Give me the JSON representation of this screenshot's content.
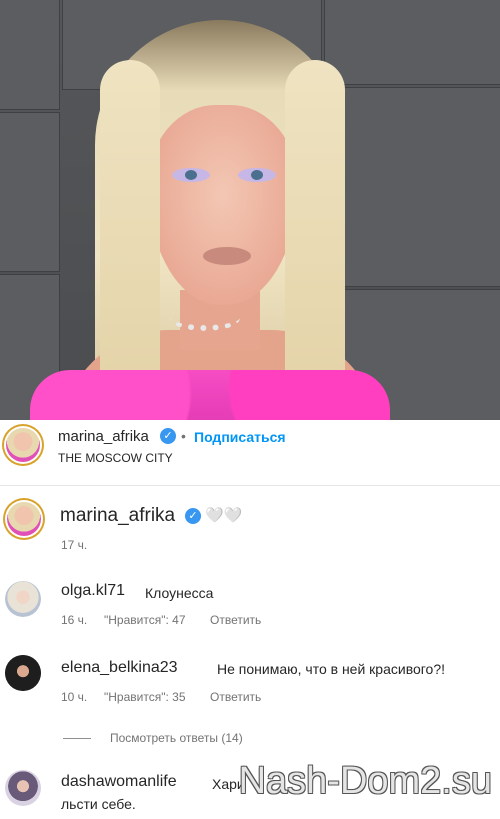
{
  "post_header": {
    "username": "marina_afrika",
    "separator": "•",
    "follow_label": "Подписаться",
    "location": "THE MOSCOW CITY"
  },
  "caption": {
    "username": "marina_afrika",
    "emoji": "🤍🤍",
    "time": "17 ч."
  },
  "comments": [
    {
      "username": "olga.kl71",
      "text": "Клоунесса",
      "time": "16 ч.",
      "likes": "\"Нравится\": 47",
      "reply_label": "Ответить"
    },
    {
      "username": "elena_belkina23",
      "text": "Не понимаю, что в ней красивого?!",
      "time": "10 ч.",
      "likes": "\"Нравится\": 35",
      "reply_label": "Ответить"
    }
  ],
  "view_replies": "Посмотреть ответы (14)",
  "last_comment": {
    "username": "dashawomanlife",
    "text_line1": "Хари",
    "text_line2": "льсти себе."
  },
  "watermark": "Nash-Dom2.su",
  "colors": {
    "follow": "#0095f6",
    "verified": "#3897f0",
    "ring": "#d8a32b"
  },
  "icons": {
    "verified": "verified-badge-icon"
  }
}
